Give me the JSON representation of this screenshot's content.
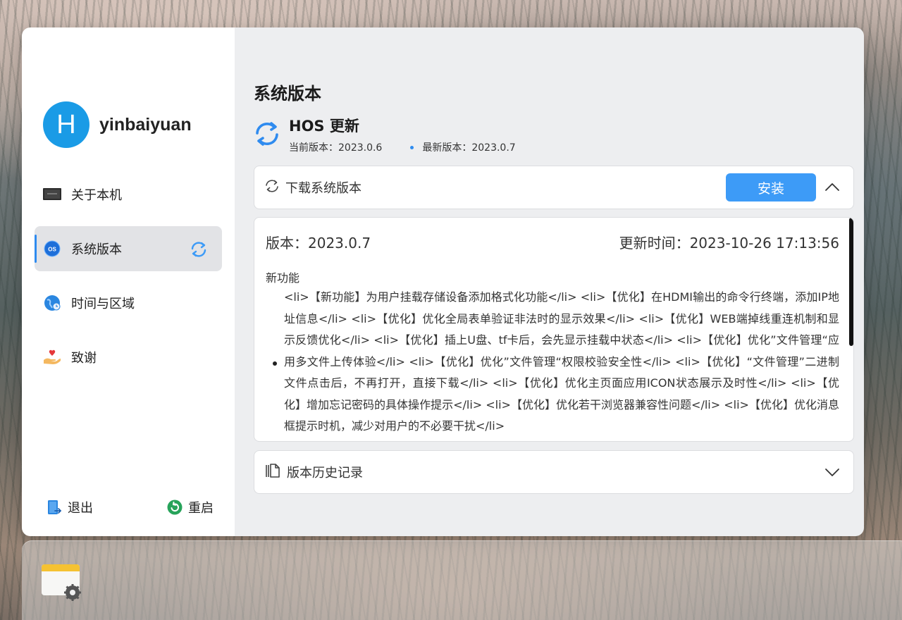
{
  "sidebar": {
    "avatar_letter": "H",
    "username": "yinbaiyuan",
    "items": [
      {
        "label": "关于本机",
        "icon": "monitor-icon"
      },
      {
        "label": "系统版本",
        "icon": "os-icon",
        "active": true,
        "badge_icon": "sync-icon"
      },
      {
        "label": "时间与区域",
        "icon": "globe-icon"
      },
      {
        "label": "致谢",
        "icon": "heart-hand-icon"
      }
    ],
    "footer": {
      "logout_label": "退出",
      "restart_label": "重启"
    }
  },
  "main": {
    "page_title": "系统版本",
    "update": {
      "title": "HOS 更新",
      "current_version": "当前版本：2023.0.6",
      "latest_version": "最新版本：2023.0.7"
    },
    "download": {
      "label": "下载系统版本",
      "install_label": "安装"
    },
    "details": {
      "version": "版本：2023.0.7",
      "updated_at": "更新时间：2023-10-26 17:13:56",
      "section_title": "新功能",
      "notes": "<li>【新功能】为用户挂载存储设备添加格式化功能</li> <li>【优化】在HDMI输出的命令行终端，添加IP地址信息</li> <li>【优化】优化全局表单验证非法时的显示效果</li> <li>【优化】WEB端掉线重连机制和显示反馈优化</li> <li>【优化】插上U盘、tf卡后，会先显示挂载中状态</li> <li>【优化】优化”文件管理“应用多文件上传体验</li> <li>【优化】优化”文件管理“权限校验安全性</li> <li>【优化】“文件管理”二进制文件点击后，不再打开，直接下载</li> <li>【优化】优化主页面应用ICON状态展示及时性</li> <li>【优化】增加忘记密码的具体操作提示</li> <li>【优化】优化若干浏览器兼容性问题</li> <li>【优化】优化消息框提示时机，减少对用户的不必要干扰</li>"
    },
    "history": {
      "label": "版本历史记录"
    }
  },
  "dock": {
    "apps": [
      {
        "icon": "settings-app-icon"
      }
    ]
  },
  "colors": {
    "accent": "#3d9bf7",
    "avatar": "#1a9be6",
    "sidebar_bg": "#ffffff",
    "main_bg": "#edeef0"
  }
}
